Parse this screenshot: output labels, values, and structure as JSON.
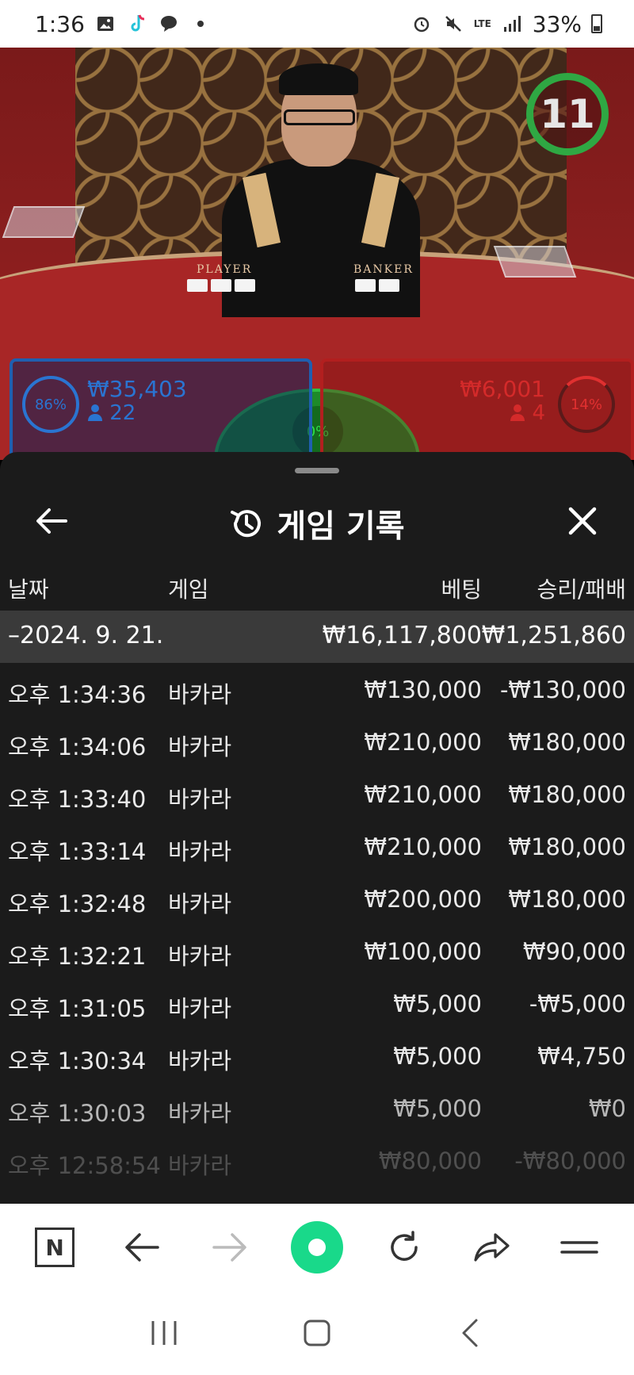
{
  "status_bar": {
    "time": "1:36",
    "battery": "33%",
    "network": "LTE"
  },
  "game": {
    "timer": "11",
    "player": {
      "percent": "86%",
      "amount": "₩35,403",
      "count": "22"
    },
    "banker": {
      "percent": "14%",
      "amount": "₩6,001",
      "count": "4"
    },
    "tie": {
      "percent": "0%"
    },
    "felt_labels": {
      "player": "PLAYER",
      "banker": "BANKER"
    }
  },
  "history": {
    "title": "게임 기록",
    "columns": {
      "date": "날짜",
      "game": "게임",
      "bet": "베팅",
      "win_loss": "승리/패배"
    },
    "summary": {
      "date": "–2024. 9. 21.",
      "bet": "₩16,117,800",
      "win_loss": "₩1,251,860"
    },
    "rows": [
      {
        "time": "오후 1:34:36",
        "game": "바카라",
        "bet": "₩130,000",
        "win_loss": "-₩130,000"
      },
      {
        "time": "오후 1:34:06",
        "game": "바카라",
        "bet": "₩210,000",
        "win_loss": "₩180,000"
      },
      {
        "time": "오후 1:33:40",
        "game": "바카라",
        "bet": "₩210,000",
        "win_loss": "₩180,000"
      },
      {
        "time": "오후 1:33:14",
        "game": "바카라",
        "bet": "₩210,000",
        "win_loss": "₩180,000"
      },
      {
        "time": "오후 1:32:48",
        "game": "바카라",
        "bet": "₩200,000",
        "win_loss": "₩180,000"
      },
      {
        "time": "오후 1:32:21",
        "game": "바카라",
        "bet": "₩100,000",
        "win_loss": "₩90,000"
      },
      {
        "time": "오후 1:31:05",
        "game": "바카라",
        "bet": "₩5,000",
        "win_loss": "-₩5,000"
      },
      {
        "time": "오후 1:30:34",
        "game": "바카라",
        "bet": "₩5,000",
        "win_loss": "₩4,750"
      },
      {
        "time": "오후 1:30:03",
        "game": "바카라",
        "bet": "₩5,000",
        "win_loss": "₩0"
      },
      {
        "time": "오후 12:58:54",
        "game": "바카라",
        "bet": "₩80,000",
        "win_loss": "-₩80,000"
      }
    ]
  },
  "toolbar": {
    "items": [
      "n-app-icon",
      "back-icon",
      "forward-icon",
      "home-icon",
      "refresh-icon",
      "share-icon",
      "menu-icon"
    ]
  },
  "colors": {
    "panel_bg": "#1b1b1b",
    "summary_bg": "#3a3a3a",
    "player_blue": "#2a74d1",
    "banker_red": "#d42a2a",
    "tie_green": "#1e8a2a",
    "accent_green": "#19d98a"
  }
}
